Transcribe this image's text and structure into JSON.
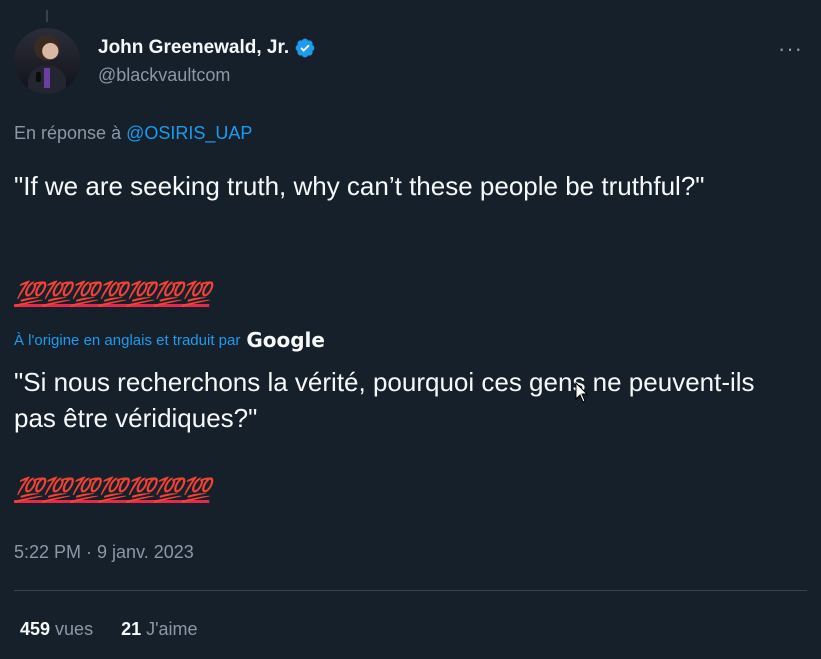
{
  "author": {
    "display_name": "John Greenewald, Jr.",
    "handle": "@blackvaultcom",
    "verified_color": "#1d9bf0"
  },
  "reply": {
    "prefix": "En réponse à ",
    "mention": "@OSIRIS_UAP"
  },
  "tweet": {
    "original_text": "\"If we are seeking truth, why can’t these people be truthful?\"",
    "emoji_line": "💯💯💯💯💯💯💯",
    "translation_note": "À l'origine en anglais et traduit par",
    "translation_provider": "Google",
    "translated_text": "\"Si nous recherchons la vérité, pourquoi ces gens ne peuvent-ils pas être véridiques?\"",
    "translated_emoji_line": "💯💯💯💯💯💯💯",
    "timestamp": "5:22 PM · 9 janv. 2023"
  },
  "stats": {
    "views_count": "459",
    "views_label": "vues",
    "likes_count": "21",
    "likes_label": "J'aime"
  },
  "menu": {
    "more_icon": "more-horizontal-icon",
    "more_glyph": "···"
  },
  "colors": {
    "background": "#15202b",
    "accent": "#1d9bf0",
    "secondary_text": "#8b98a5",
    "hundred_emoji": "#e8284a"
  }
}
